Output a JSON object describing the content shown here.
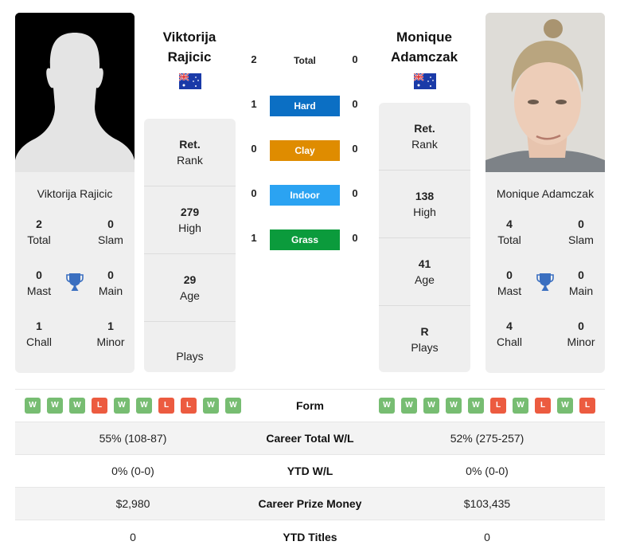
{
  "players": [
    {
      "name_line1": "Viktorija",
      "name_line2": "Rajicic",
      "full_name": "Viktorija Rajicic",
      "country_flag": "australia-flag",
      "photo": "silhouette-placeholder",
      "rank": {
        "value": "Ret.",
        "label": "Rank"
      },
      "high": {
        "value": "279",
        "label": "High"
      },
      "age": {
        "value": "29",
        "label": "Age"
      },
      "plays": {
        "value": "",
        "label": "Plays"
      },
      "titles": {
        "total": {
          "value": "2",
          "label": "Total"
        },
        "slam": {
          "value": "0",
          "label": "Slam"
        },
        "mast": {
          "value": "0",
          "label": "Mast"
        },
        "main": {
          "value": "0",
          "label": "Main"
        },
        "chall": {
          "value": "1",
          "label": "Chall"
        },
        "minor": {
          "value": "1",
          "label": "Minor"
        }
      },
      "form": [
        "W",
        "W",
        "W",
        "L",
        "W",
        "W",
        "L",
        "L",
        "W",
        "W"
      ],
      "career_wl": "55% (108-87)",
      "ytd_wl": "0% (0-0)",
      "prize_money": "$2,980",
      "ytd_titles": "0"
    },
    {
      "name_line1": "Monique",
      "name_line2": "Adamczak",
      "full_name": "Monique Adamczak",
      "country_flag": "australia-flag",
      "photo": "player-photo",
      "rank": {
        "value": "Ret.",
        "label": "Rank"
      },
      "high": {
        "value": "138",
        "label": "High"
      },
      "age": {
        "value": "41",
        "label": "Age"
      },
      "plays": {
        "value": "R",
        "label": "Plays"
      },
      "titles": {
        "total": {
          "value": "4",
          "label": "Total"
        },
        "slam": {
          "value": "0",
          "label": "Slam"
        },
        "mast": {
          "value": "0",
          "label": "Mast"
        },
        "main": {
          "value": "0",
          "label": "Main"
        },
        "chall": {
          "value": "4",
          "label": "Chall"
        },
        "minor": {
          "value": "0",
          "label": "Minor"
        }
      },
      "form": [
        "W",
        "W",
        "W",
        "W",
        "W",
        "L",
        "W",
        "L",
        "W",
        "L"
      ],
      "career_wl": "52% (275-257)",
      "ytd_wl": "0% (0-0)",
      "prize_money": "$103,435",
      "ytd_titles": "0"
    }
  ],
  "h2h": {
    "total": {
      "label": "Total",
      "left": "2",
      "right": "0"
    },
    "surfaces": [
      {
        "label": "Hard",
        "left": "1",
        "right": "0",
        "color": "#0b6fc4"
      },
      {
        "label": "Clay",
        "left": "0",
        "right": "0",
        "color": "#df8c00"
      },
      {
        "label": "Indoor",
        "left": "0",
        "right": "0",
        "color": "#2ba3f2"
      },
      {
        "label": "Grass",
        "left": "1",
        "right": "0",
        "color": "#0b9b3c"
      }
    ]
  },
  "stats_labels": {
    "form": "Form",
    "career_wl": "Career Total W/L",
    "ytd_wl": "YTD W/L",
    "prize_money": "Career Prize Money",
    "ytd_titles": "YTD Titles"
  },
  "colors": {
    "win": "#77bd72",
    "loss": "#ec5b40",
    "trophy": "#3a6fc0",
    "card_bg": "#efefef"
  }
}
